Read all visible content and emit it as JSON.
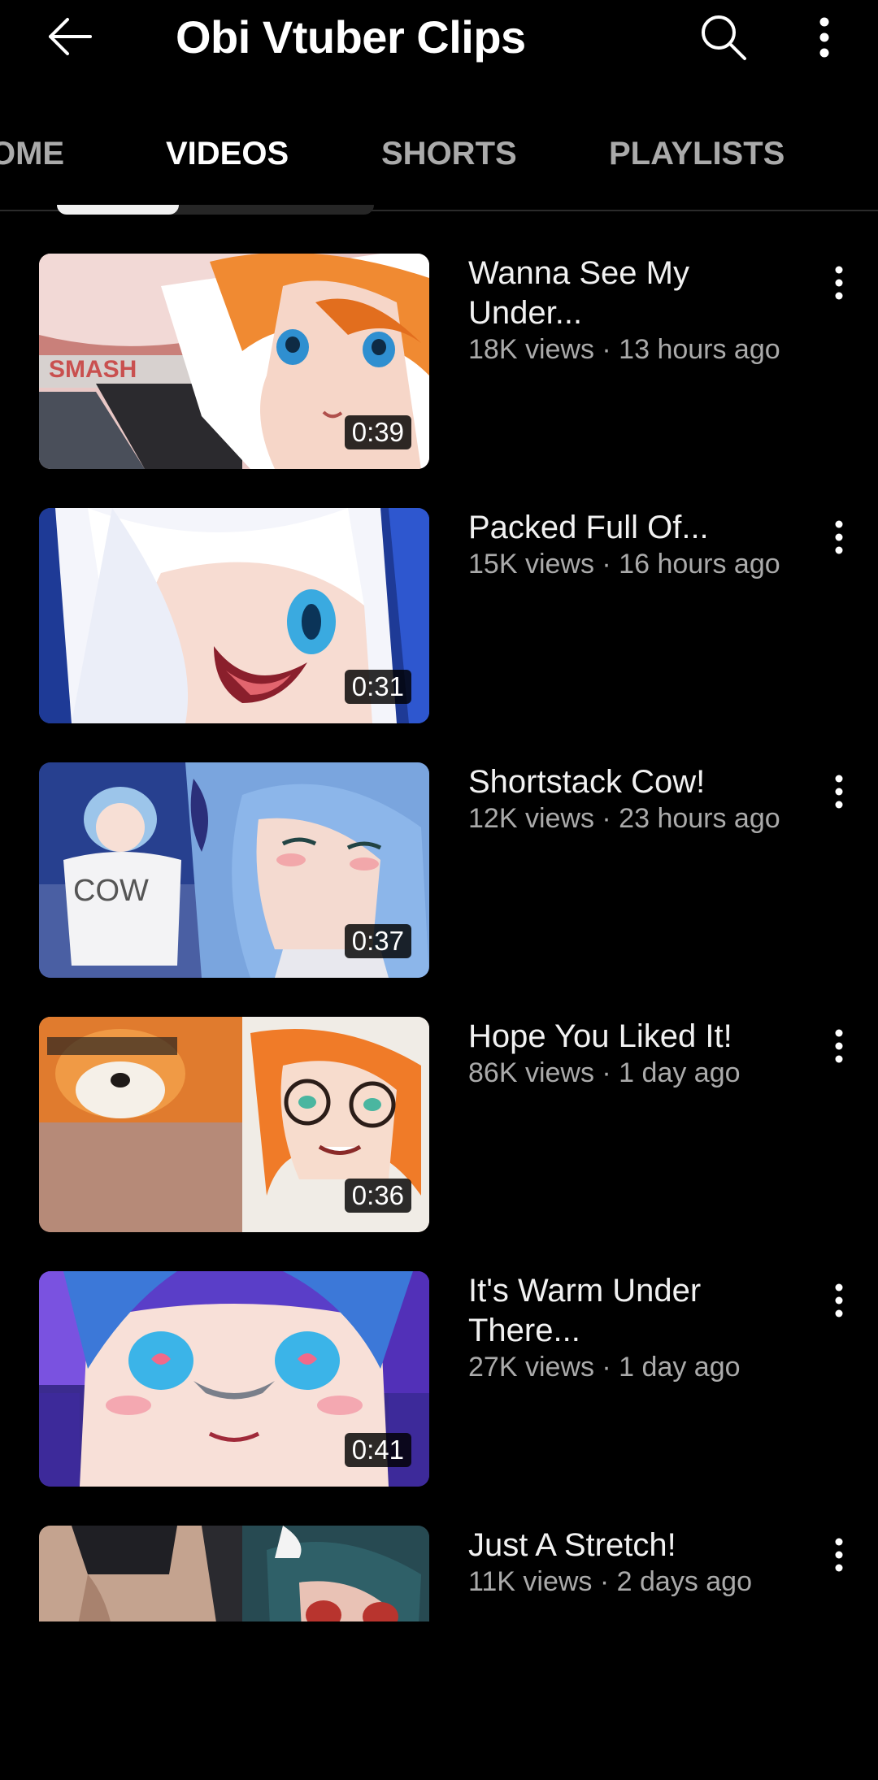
{
  "header": {
    "title": "Obi Vtuber Clips",
    "back_icon": "arrow-back-icon",
    "search_icon": "search-icon",
    "more_icon": "more-vert-icon"
  },
  "tabs": [
    {
      "label": "HOME",
      "visible_label": "OME",
      "active": false
    },
    {
      "label": "VIDEOS",
      "active": true
    },
    {
      "label": "SHORTS",
      "active": false
    },
    {
      "label": "PLAYLISTS",
      "active": false
    }
  ],
  "videos": [
    {
      "title_line1": "Wanna See My",
      "title_line2": "Under...",
      "meta": "18K views · 13 hours ago",
      "duration": "0:39",
      "thumb_text": "SMASH"
    },
    {
      "title_line1": "Packed Full Of...",
      "title_line2": "",
      "meta": "15K views · 16 hours ago",
      "duration": "0:31"
    },
    {
      "title_line1": "Shortstack Cow!",
      "title_line2": "",
      "meta": "12K views · 23 hours ago",
      "duration": "0:37",
      "thumb_text": "COW"
    },
    {
      "title_line1": "Hope You Liked It!",
      "title_line2": "",
      "meta": "86K views · 1 day ago",
      "duration": "0:36"
    },
    {
      "title_line1": "It's Warm Under",
      "title_line2": "There...",
      "meta": "27K views · 1 day ago",
      "duration": "0:41"
    },
    {
      "title_line1": "Just A Stretch!",
      "title_line2": "",
      "meta": "11K views · 2 days ago",
      "duration": ""
    }
  ],
  "colors": {
    "background": "#000000",
    "primary_text": "#f1f1f1",
    "secondary_text": "#aaaaaa",
    "divider": "#2b2b2b"
  }
}
